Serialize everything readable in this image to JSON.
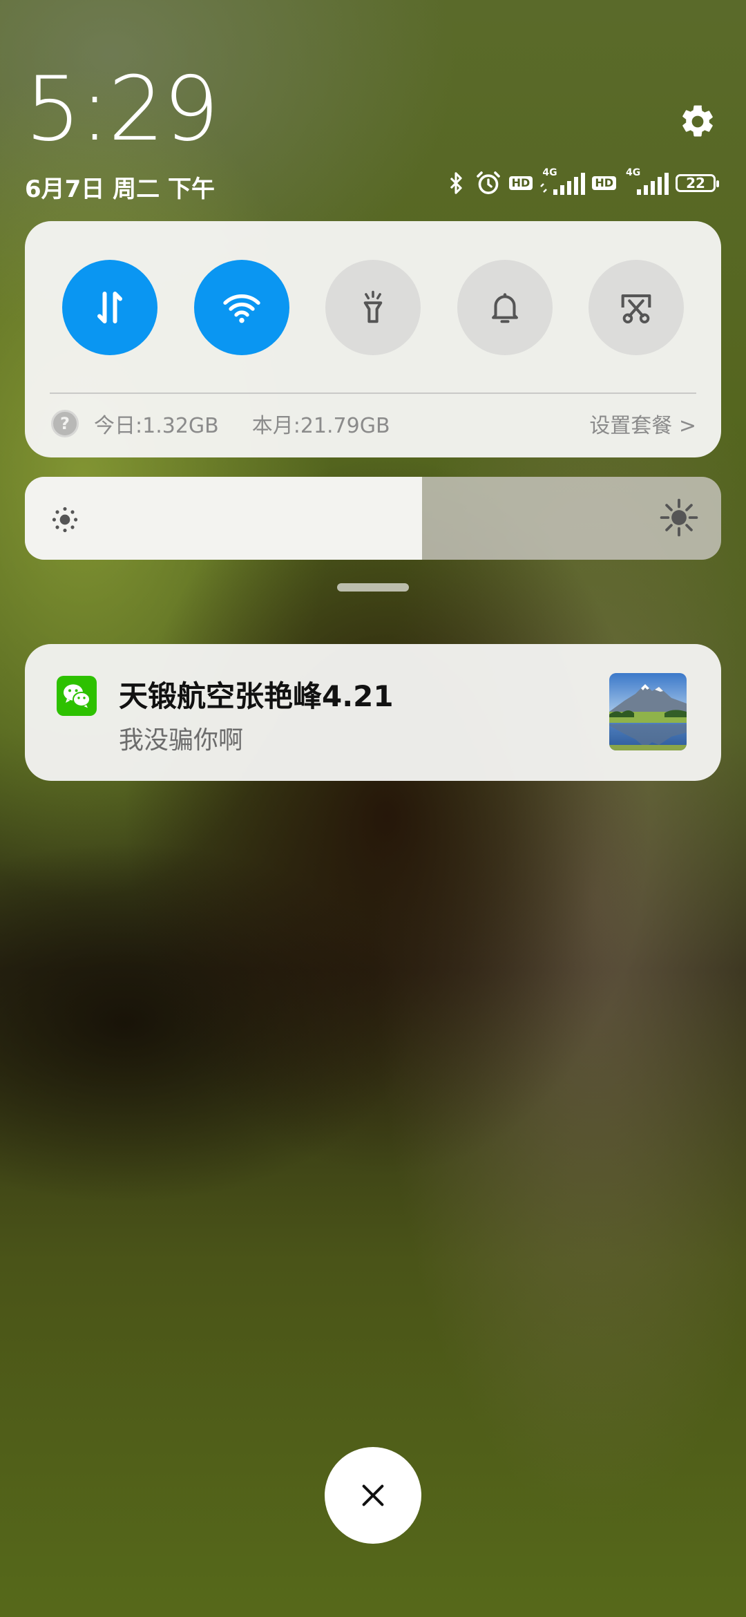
{
  "status": {
    "time": "5:29",
    "date": "6月7日 周二 下午",
    "network1": "4G",
    "network2": "4G",
    "hd1": "HD",
    "hd2": "HD",
    "battery": "22",
    "icons": [
      "bluetooth-icon",
      "alarm-icon",
      "hd-icon",
      "signal-icon",
      "hd-icon",
      "signal-icon",
      "battery-icon"
    ]
  },
  "quick_toggles": [
    {
      "name": "mobile-data",
      "icon": "data-arrows-icon",
      "active": true
    },
    {
      "name": "wifi",
      "icon": "wifi-icon",
      "active": true
    },
    {
      "name": "flashlight",
      "icon": "flashlight-icon",
      "active": false
    },
    {
      "name": "ringer",
      "icon": "bell-icon",
      "active": false
    },
    {
      "name": "screenshot",
      "icon": "screenshot-scissors-icon",
      "active": false
    }
  ],
  "data_usage": {
    "help": "?",
    "today": "今日:1.32GB",
    "month": "本月:21.79GB",
    "plan_link": "设置套餐 >"
  },
  "brightness": {
    "level": 0.57
  },
  "notification": {
    "app_icon": "wechat-icon",
    "title": "天锻航空张艳峰4.21",
    "body": "我没骗你啊"
  },
  "colors": {
    "accent": "#0a96f2",
    "toggle_off": "#dcdcda",
    "wechat": "#2dc100"
  }
}
